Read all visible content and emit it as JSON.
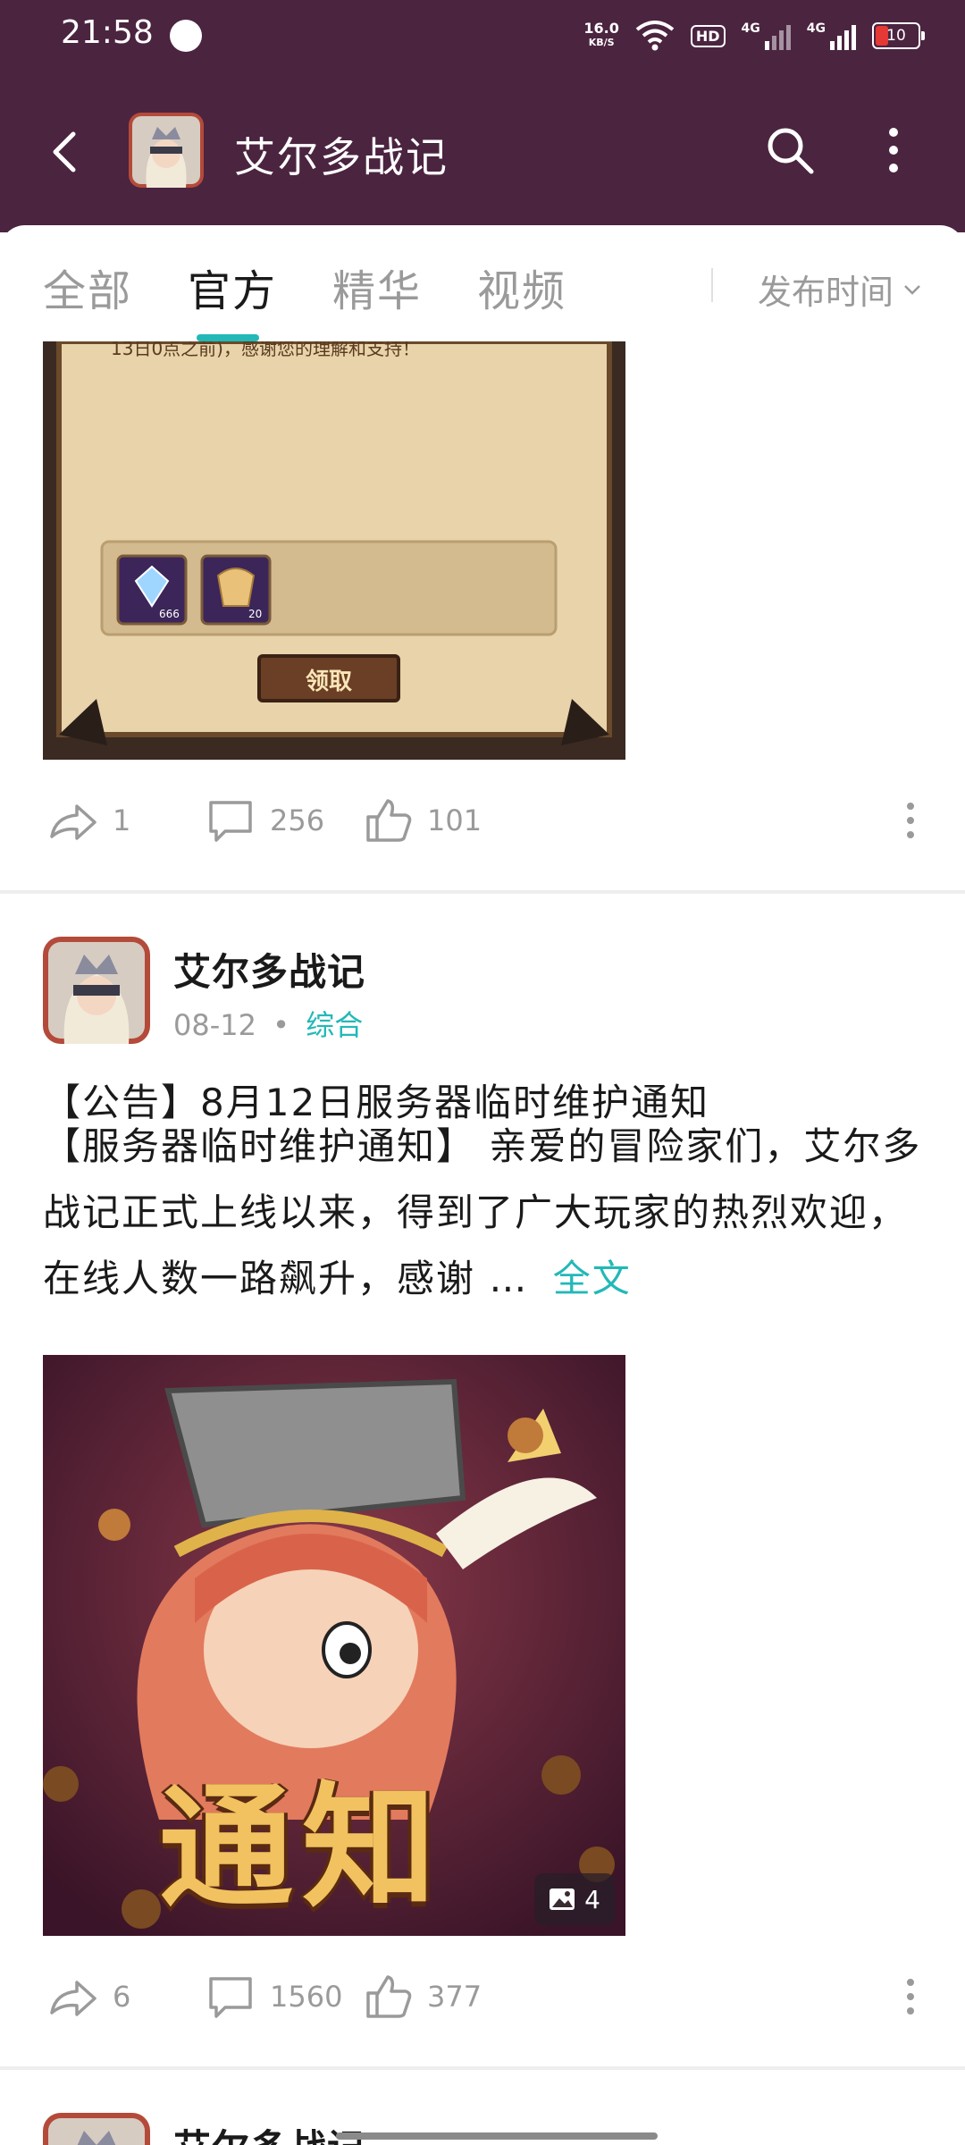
{
  "status": {
    "time": "21:58",
    "speed_value": "16.0",
    "speed_unit": "KB/S",
    "hd_label": "HD",
    "network_1": "4G",
    "network_2": "4G",
    "battery": "10"
  },
  "appbar": {
    "title": "艾尔多战记"
  },
  "tabs": {
    "items": [
      "全部",
      "官方",
      "精华",
      "视频"
    ],
    "active": "官方",
    "sort_label": "发布时间"
  },
  "posts": [
    {
      "image": {
        "notice_text": "13日0点之前)，感谢您的理解和支持！",
        "item1_count": "666",
        "item2_count": "20",
        "claim_label": "领取"
      },
      "shares": "1",
      "comments": "256",
      "likes": "101"
    },
    {
      "author": "艾尔多战记",
      "date": "08-12",
      "separator": "•",
      "category": "综合",
      "title": "【公告】8月12日服务器临时维护通知",
      "excerpt": "【服务器临时维护通知】 亲爱的冒险家们，艾尔多战记正式上线以来，得到了广大玩家的热烈欢迎，在线人数一路飙升，感谢 …",
      "more_label": "全文",
      "image": {
        "banner_text": "通知",
        "image_count": "4"
      },
      "shares": "6",
      "comments": "1560",
      "likes": "377"
    },
    {
      "author": "艾尔多战记"
    }
  ],
  "colors": {
    "header_bg": "#4b2440",
    "accent": "#23b8b8",
    "muted_text": "#9a9a9a"
  }
}
